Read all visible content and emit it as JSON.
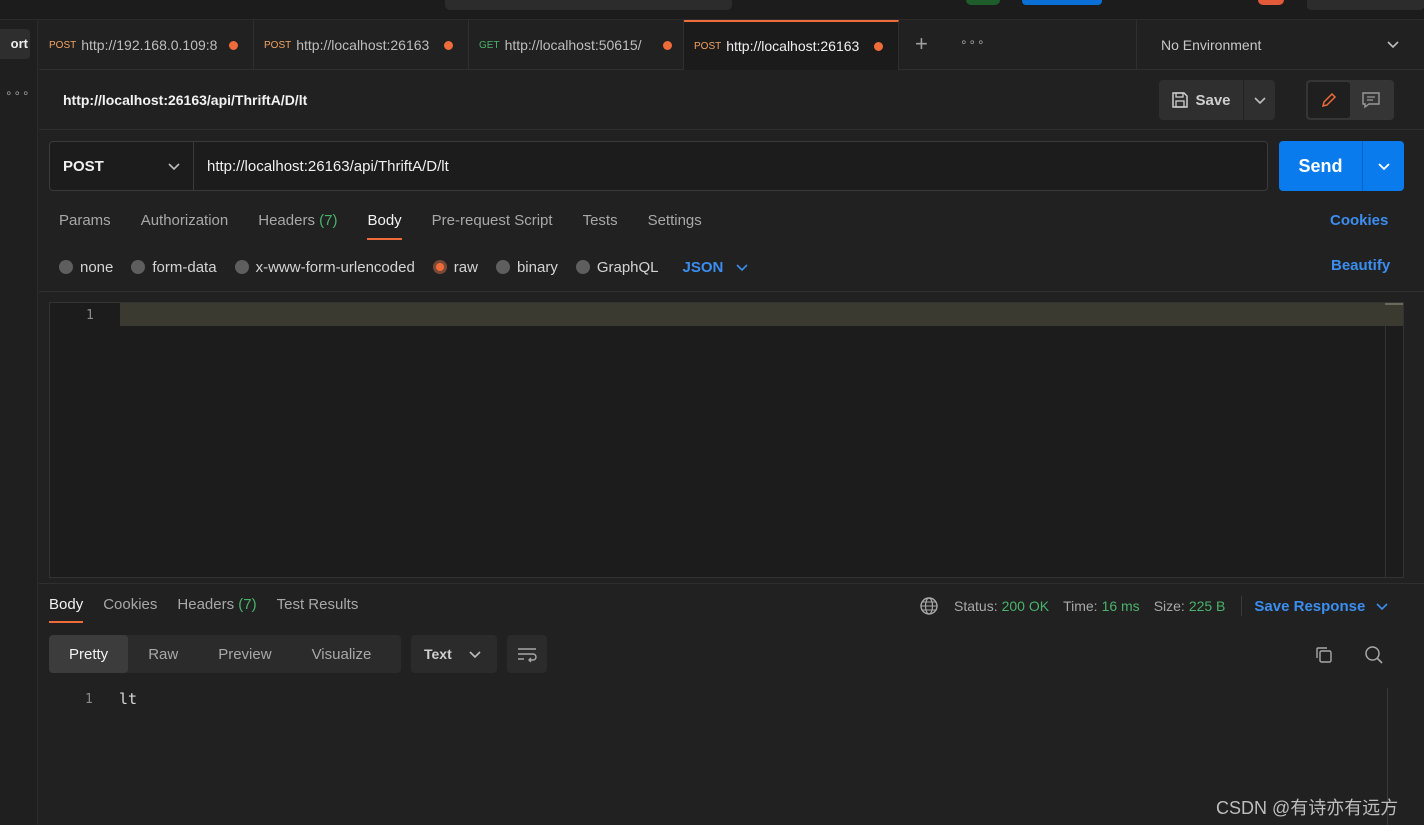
{
  "left_sidebar": {
    "import_label": "ort",
    "more": "∘∘∘"
  },
  "tabs": [
    {
      "method": "POST",
      "url": "http://192.168.0.109:8",
      "unsaved": true
    },
    {
      "method": "POST",
      "url": "http://localhost:26163",
      "unsaved": true
    },
    {
      "method": "GET",
      "url": "http://localhost:50615/",
      "unsaved": true
    },
    {
      "method": "POST",
      "url": "http://localhost:26163",
      "unsaved": true,
      "active": true
    }
  ],
  "tab_actions": {
    "add": "+",
    "more": "∘∘∘"
  },
  "environment": {
    "selected": "No Environment"
  },
  "request": {
    "title": "http://localhost:26163/api/ThriftA/D/lt",
    "method": "POST",
    "url": "http://localhost:26163/api/ThriftA/D/lt",
    "save_label": "Save",
    "send_label": "Send"
  },
  "request_tabs": {
    "params": "Params",
    "authorization": "Authorization",
    "headers": "Headers",
    "headers_count": "(7)",
    "body": "Body",
    "pre_request": "Pre-request Script",
    "tests": "Tests",
    "settings": "Settings",
    "cookies": "Cookies"
  },
  "body_types": {
    "none": "none",
    "form_data": "form-data",
    "urlencoded": "x-www-form-urlencoded",
    "raw": "raw",
    "binary": "binary",
    "graphql": "GraphQL",
    "language": "JSON",
    "beautify": "Beautify",
    "selected": "raw"
  },
  "editor": {
    "line_number": "1",
    "content": ""
  },
  "response_tabs": {
    "body": "Body",
    "cookies": "Cookies",
    "headers": "Headers",
    "headers_count": "(7)",
    "test_results": "Test Results"
  },
  "response_meta": {
    "status_label": "Status:",
    "status_value": "200 OK",
    "time_label": "Time:",
    "time_value": "16 ms",
    "size_label": "Size:",
    "size_value": "225 B",
    "save_response": "Save Response"
  },
  "response_view": {
    "pretty": "Pretty",
    "raw": "Raw",
    "preview": "Preview",
    "visualize": "Visualize",
    "format": "Text"
  },
  "response_body": {
    "line_number": "1",
    "content": "lt"
  },
  "watermark": "CSDN @有诗亦有远方",
  "colors": {
    "accent": "#ef6c3a",
    "primary": "#097bed",
    "link": "#3b8ef0",
    "success": "#49b36b",
    "background": "#212121"
  }
}
